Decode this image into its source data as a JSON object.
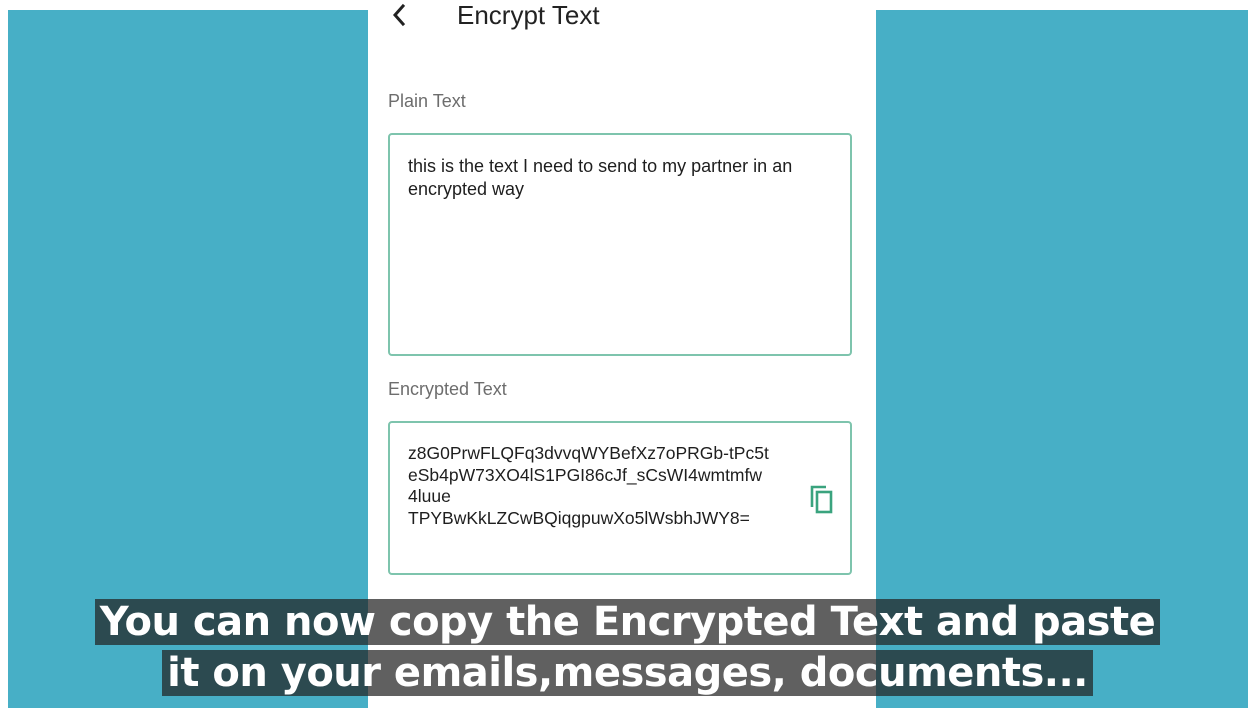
{
  "header": {
    "title": "Encrypt Text",
    "back_icon": "chevron-left-icon"
  },
  "plain": {
    "label": "Plain Text",
    "value": "this is the text I need to send to my partner in an encrypted way"
  },
  "encrypted": {
    "label": "Encrypted Text",
    "lines": [
      "z8G0PrwFLQFq3dvvqWYBefXz7oPRGb-tPc5t",
      "eSb4pW73XO4lS1PGI86cJf_sCsWI4wmtmfw",
      "4luue",
      "TPYBwKkLZCwBQiqgpuwXo5lWsbhJWY8="
    ],
    "copy_icon": "copy-icon"
  },
  "caption": {
    "line1": "You can now copy the Encrypted Text and paste",
    "line2": "it on your emails,messages, documents..."
  },
  "colors": {
    "background": "#47afc6",
    "field_border": "#7ec4ad",
    "icon": "#3aa37e"
  }
}
